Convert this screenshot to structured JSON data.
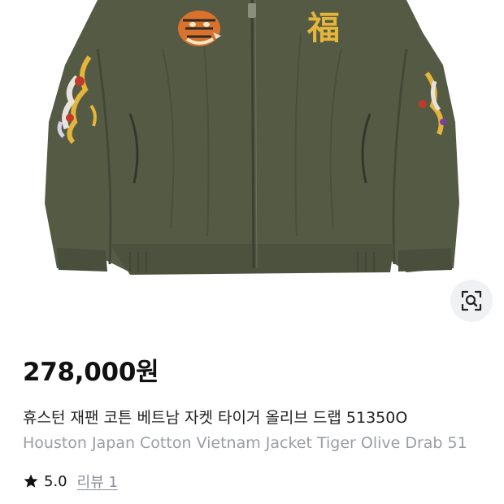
{
  "product": {
    "image_alt": "Olive drab zip-up jacket with embroidered tiger head, 福 character and dragon sleeves",
    "embroidery_character": "福",
    "colors": {
      "jacket": "#555a45",
      "jacket_shadow": "#454938",
      "embroidery_gold": "#e3b53b"
    },
    "price": "278,000원",
    "title_ko": "휴스턴 재팬 코튼 베트남 자켓 타이거 올리브 드랩 51350O",
    "title_en": "Houston Japan Cotton Vietnam Jacket Tiger Olive Drab 51",
    "rating": "5.0",
    "review_link": "리뷰 1"
  },
  "icons": {
    "lens": "image-search-icon",
    "star": "star-icon"
  }
}
